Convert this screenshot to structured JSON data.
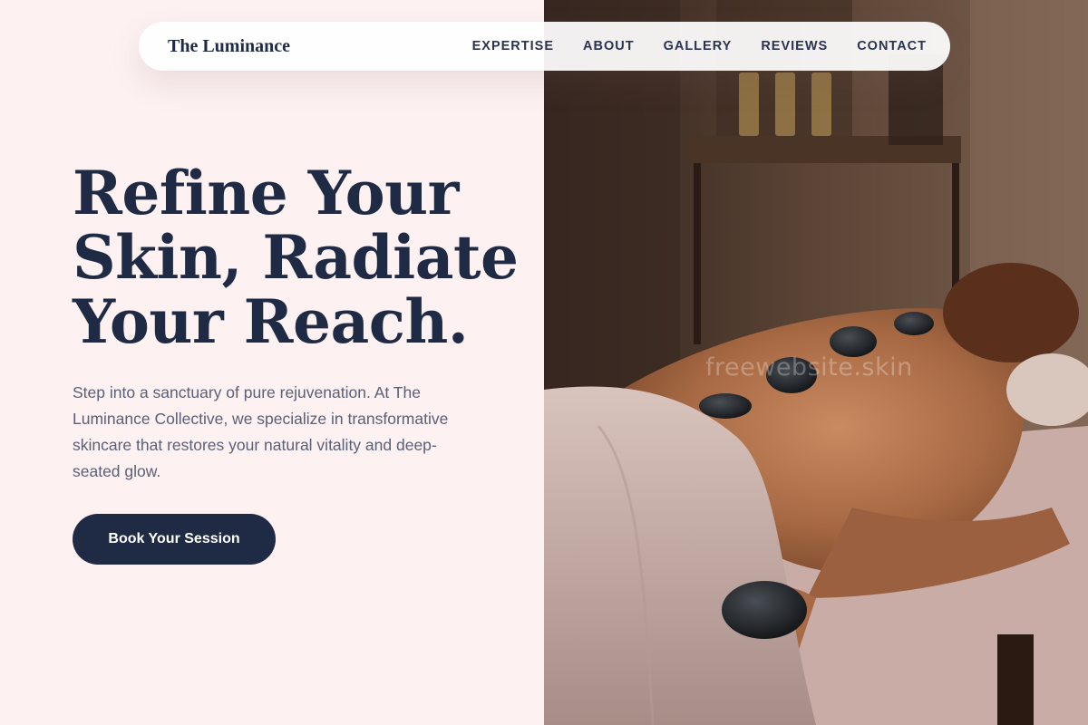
{
  "brand": {
    "name": "The Luminance"
  },
  "nav": {
    "items": [
      {
        "label": "EXPERTISE"
      },
      {
        "label": "ABOUT"
      },
      {
        "label": "GALLERY"
      },
      {
        "label": "REVIEWS"
      },
      {
        "label": "CONTACT"
      }
    ]
  },
  "hero": {
    "title_lines": [
      "Refine Your",
      "Skin, Radiate",
      "Your Reach."
    ],
    "description": "Step into a sanctuary of pure rejuvenation. At The Luminance Collective, we specialize in transformative skincare that restores your natural vitality and deep-seated glow.",
    "cta_label": "Book Your Session"
  },
  "image": {
    "subject": "hot-stone-massage-photo",
    "watermark": "freewebsite.skin"
  },
  "colors": {
    "navy": "#1f2a44",
    "blush": "#fdf1f1",
    "text_muted": "#5a6076"
  }
}
